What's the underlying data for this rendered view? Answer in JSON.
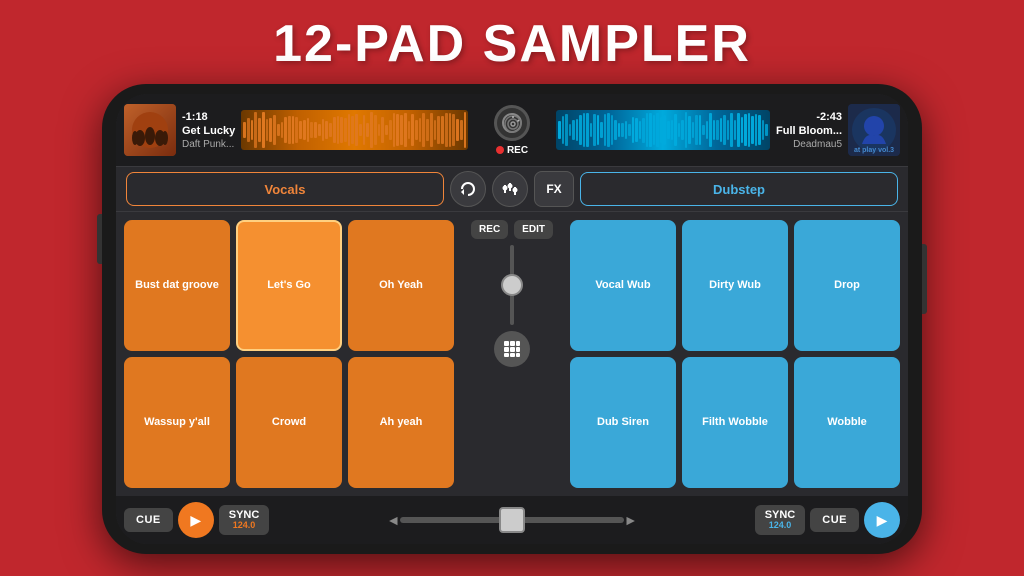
{
  "title": "12-PAD SAMPLER",
  "phone": {
    "deck_left": {
      "time": "-1:18",
      "track": "Get Lucky",
      "artist": "Daft Punk...",
      "waveform_color": "#e07820"
    },
    "deck_right": {
      "time": "-2:43",
      "track": "Full Bloom...",
      "artist": "Deadmau5",
      "waveform_color": "#00aadd"
    },
    "rec_label": "REC",
    "controls": {
      "category_left": "Vocals",
      "category_right": "Dubstep",
      "fx_label": "FX"
    },
    "pads_left": [
      {
        "label": "Bust dat groove",
        "active": false
      },
      {
        "label": "Let's Go",
        "active": true
      },
      {
        "label": "Oh Yeah",
        "active": false
      },
      {
        "label": "Wassup y'all",
        "active": false
      },
      {
        "label": "Crowd",
        "active": false
      },
      {
        "label": "Ah yeah",
        "active": false
      }
    ],
    "pads_right": [
      {
        "label": "Vocal Wub",
        "active": false
      },
      {
        "label": "Dirty Wub",
        "active": false
      },
      {
        "label": "Drop",
        "active": false
      },
      {
        "label": "Dub Siren",
        "active": false
      },
      {
        "label": "Filth Wobble",
        "active": false
      },
      {
        "label": "Wobble",
        "active": false
      }
    ],
    "center": {
      "rec_label": "REC",
      "edit_label": "EDIT"
    },
    "transport": {
      "cue_left": "CUE",
      "play_left": "▶",
      "sync_left": "SYNC",
      "bpm_left": "124.0",
      "arrow_left": "◄",
      "arrow_right": "►",
      "sync_right": "SYNC",
      "bpm_right": "124.0",
      "cue_right": "CUE",
      "play_right": "▶"
    }
  }
}
